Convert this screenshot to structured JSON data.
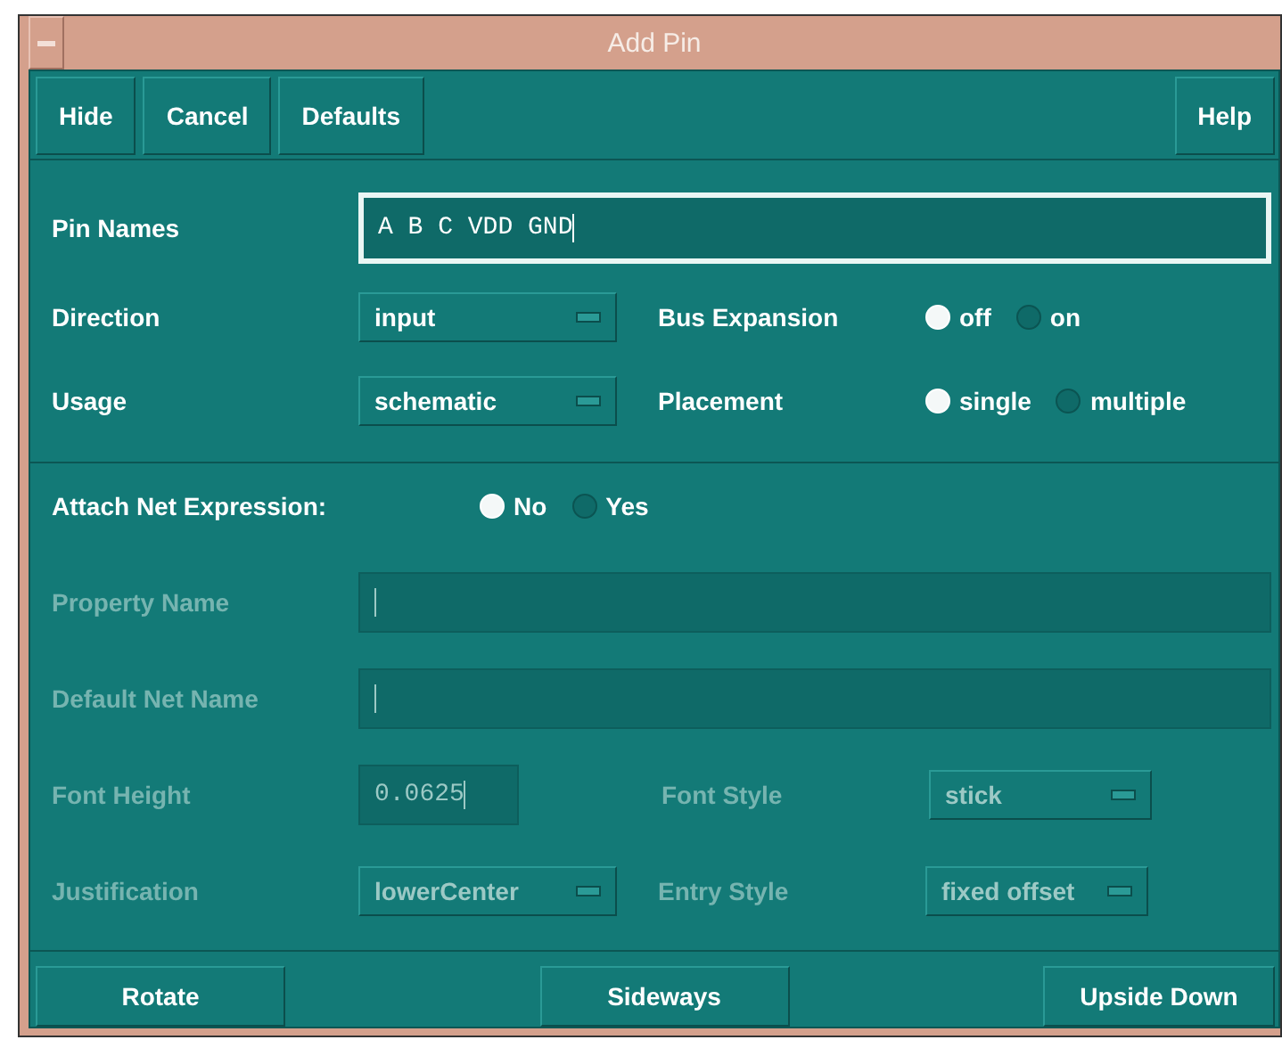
{
  "window": {
    "title": "Add Pin"
  },
  "toolbar": [
    {
      "label": "Hide",
      "kind": "left"
    },
    {
      "label": "Cancel",
      "kind": "left"
    },
    {
      "label": "Defaults",
      "kind": "left"
    },
    {
      "label": "Help",
      "kind": "right"
    }
  ],
  "sections": [
    {
      "rows": [
        [
          {
            "kind": "text",
            "label": "Pin Names",
            "value": "A B C VDD GND",
            "focused": true,
            "disabled": false
          }
        ],
        [
          {
            "kind": "cycle",
            "label": "Direction",
            "value": "input",
            "disabled": false
          },
          {
            "kind": "radio",
            "label": "Bus Expansion",
            "disabled": false,
            "options": [
              {
                "label": "off",
                "selected": true
              },
              {
                "label": "on",
                "selected": false
              }
            ]
          }
        ],
        [
          {
            "kind": "cycle",
            "label": "Usage",
            "value": "schematic",
            "disabled": false
          },
          {
            "kind": "radio",
            "label": "Placement",
            "disabled": false,
            "options": [
              {
                "label": "single",
                "selected": true
              },
              {
                "label": "multiple",
                "selected": false
              }
            ]
          }
        ]
      ]
    },
    {
      "rows": [
        [
          {
            "kind": "inline_radio",
            "label": "Attach Net Expression:",
            "disabled": false,
            "options": [
              {
                "label": "No",
                "selected": true
              },
              {
                "label": "Yes",
                "selected": false
              }
            ]
          }
        ],
        [
          {
            "kind": "text",
            "label": "Property Name",
            "focused": false,
            "disabled": true
          }
        ],
        [
          {
            "kind": "text",
            "label": "Default Net Name",
            "focused": false,
            "disabled": true
          }
        ],
        [
          {
            "kind": "number",
            "label": "Font Height",
            "value": "0.0625",
            "disabled": true
          },
          {
            "kind": "cycle",
            "label": "Font Style",
            "value": "stick",
            "disabled": true
          }
        ],
        [
          {
            "kind": "cycle",
            "label": "Justification",
            "value": "lowerCenter",
            "disabled": true
          },
          {
            "kind": "cycle",
            "label": "Entry Style",
            "value": "fixed offset",
            "disabled": true
          }
        ]
      ]
    }
  ],
  "bottom_buttons": [
    {
      "label": "Rotate"
    },
    {
      "label": "Sideways"
    },
    {
      "label": "Upside Down"
    }
  ]
}
